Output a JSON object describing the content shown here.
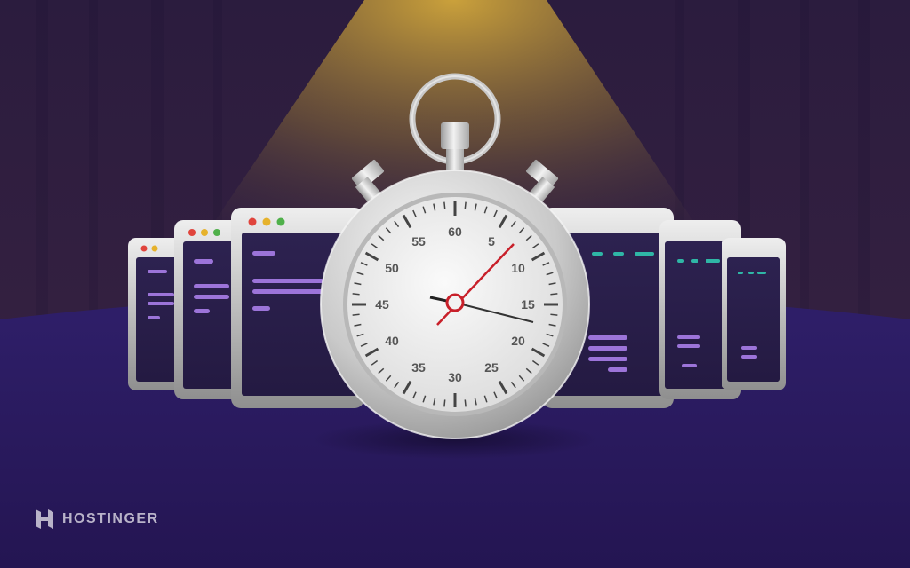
{
  "brand": {
    "name": "HOSTINGER",
    "logo_icon": "hostinger-h-logo-icon"
  },
  "stopwatch": {
    "dial_numbers": [
      "60",
      "5",
      "10",
      "15",
      "20",
      "25",
      "30",
      "35",
      "40",
      "45",
      "50",
      "55"
    ],
    "buttons": [
      "crown-button",
      "left-pusher-button",
      "right-pusher-button"
    ]
  },
  "browser_windows": {
    "count": 6,
    "traffic_lights": [
      "#e0443c",
      "#e6b22c",
      "#4fb04a"
    ],
    "content_colors": [
      "#9c74d9",
      "#2fb6a6"
    ]
  },
  "colors": {
    "background": "#2a1a4e",
    "floor": "#2c1b63",
    "spotlight": "#d1a83b",
    "second_hand": "#c8202a"
  }
}
